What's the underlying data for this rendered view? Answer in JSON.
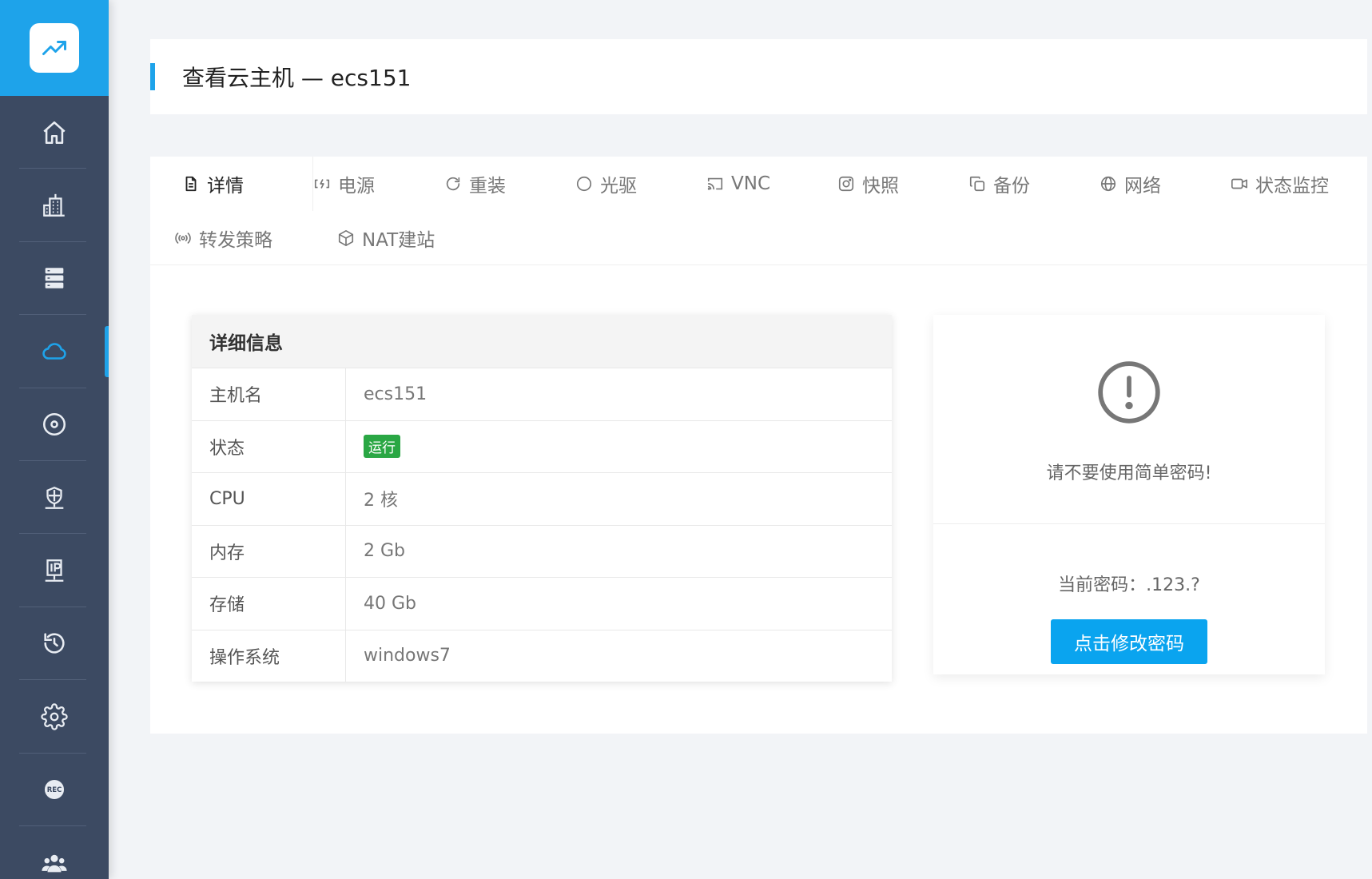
{
  "sidebar": {
    "logo_icon": "trending-up-icon",
    "items": [
      {
        "icon": "home-icon"
      },
      {
        "icon": "building-icon"
      },
      {
        "icon": "server-icon"
      },
      {
        "icon": "cloud-icon",
        "active": true
      },
      {
        "icon": "disc-icon"
      },
      {
        "icon": "shield-network-icon"
      },
      {
        "icon": "ip-network-icon"
      },
      {
        "icon": "history-icon"
      },
      {
        "icon": "gear-icon"
      },
      {
        "icon": "rec-icon"
      },
      {
        "icon": "users-icon"
      }
    ]
  },
  "header": {
    "title": "查看云主机 — ecs151"
  },
  "tabs": [
    {
      "label": "详情",
      "icon": "document-icon",
      "active": true
    },
    {
      "label": "电源",
      "icon": "power-icon"
    },
    {
      "label": "重装",
      "icon": "refresh-icon"
    },
    {
      "label": "光驱",
      "icon": "circle-icon"
    },
    {
      "label": "VNC",
      "icon": "cast-icon"
    },
    {
      "label": "快照",
      "icon": "camera-icon"
    },
    {
      "label": "备份",
      "icon": "copy-icon"
    },
    {
      "label": "网络",
      "icon": "globe-icon"
    },
    {
      "label": "状态监控",
      "icon": "video-icon"
    },
    {
      "label": "转发策略",
      "icon": "broadcast-icon"
    },
    {
      "label": "NAT建站",
      "icon": "box-icon"
    }
  ],
  "details": {
    "title": "详细信息",
    "rows": [
      {
        "label": "主机名",
        "value": "ecs151"
      },
      {
        "label": "状态",
        "value": "运行"
      },
      {
        "label": "CPU",
        "value": "2 核"
      },
      {
        "label": "内存",
        "value": "2 Gb"
      },
      {
        "label": "存储",
        "value": "40 Gb"
      },
      {
        "label": "操作系统",
        "value": "windows7"
      }
    ]
  },
  "warning": {
    "icon": "alert-circle-icon",
    "message": "请不要使用简单密码!",
    "password_text": "当前密码：.123.?",
    "button_label": "点击修改密码"
  },
  "colors": {
    "accent": "#1ea3ea",
    "sidebar_bg": "#3c4a62",
    "status_green": "#2aa744",
    "button_blue": "#0aa4ef"
  }
}
